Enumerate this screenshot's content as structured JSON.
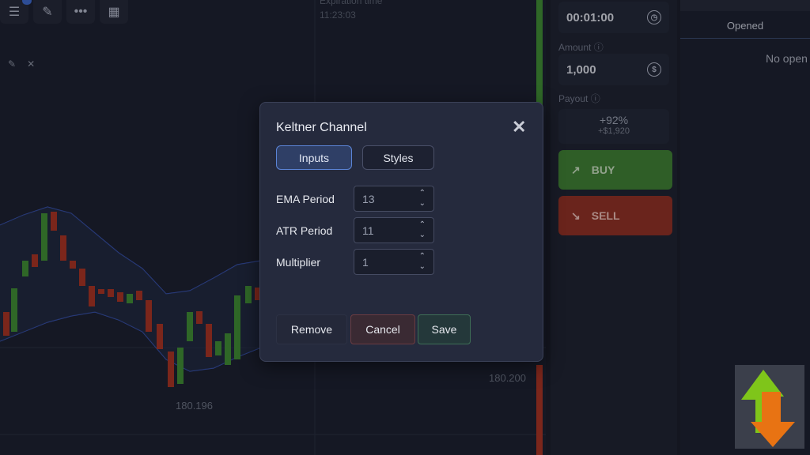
{
  "toolbar": {
    "icons": [
      "sliders-icon",
      "brush-icon",
      "more-icon",
      "grid-icon"
    ],
    "more_glyph": "•••"
  },
  "chart": {
    "expiration_label": "Expiration time",
    "expiration_value": "11:23:03",
    "price_left": "180.196",
    "price_right": "180.200"
  },
  "trade_panel": {
    "time_value": "00:01:00",
    "amount_label": "Amount",
    "amount_value": "1,000",
    "payout_label": "Payout",
    "payout_percent": "+92%",
    "payout_amount": "+$1,920",
    "buy_label": "BUY",
    "sell_label": "SELL",
    "buy_color": "#3f7e34",
    "sell_color": "#8e3026"
  },
  "right_panel": {
    "tab_label": "Opened",
    "empty_text": "No open"
  },
  "modal": {
    "title": "Keltner Channel",
    "tabs": [
      {
        "label": "Inputs",
        "active": true
      },
      {
        "label": "Styles",
        "active": false
      }
    ],
    "fields": [
      {
        "label": "EMA Period",
        "value": "13"
      },
      {
        "label": "ATR Period",
        "value": "11"
      },
      {
        "label": "Multiplier",
        "value": "1"
      }
    ],
    "remove_label": "Remove",
    "cancel_label": "Cancel",
    "save_label": "Save",
    "accent_color": "#5b84d6"
  },
  "logo": {
    "name": "up-down-arrows-logo",
    "colors": [
      "#7fc51a",
      "#e87313"
    ]
  }
}
